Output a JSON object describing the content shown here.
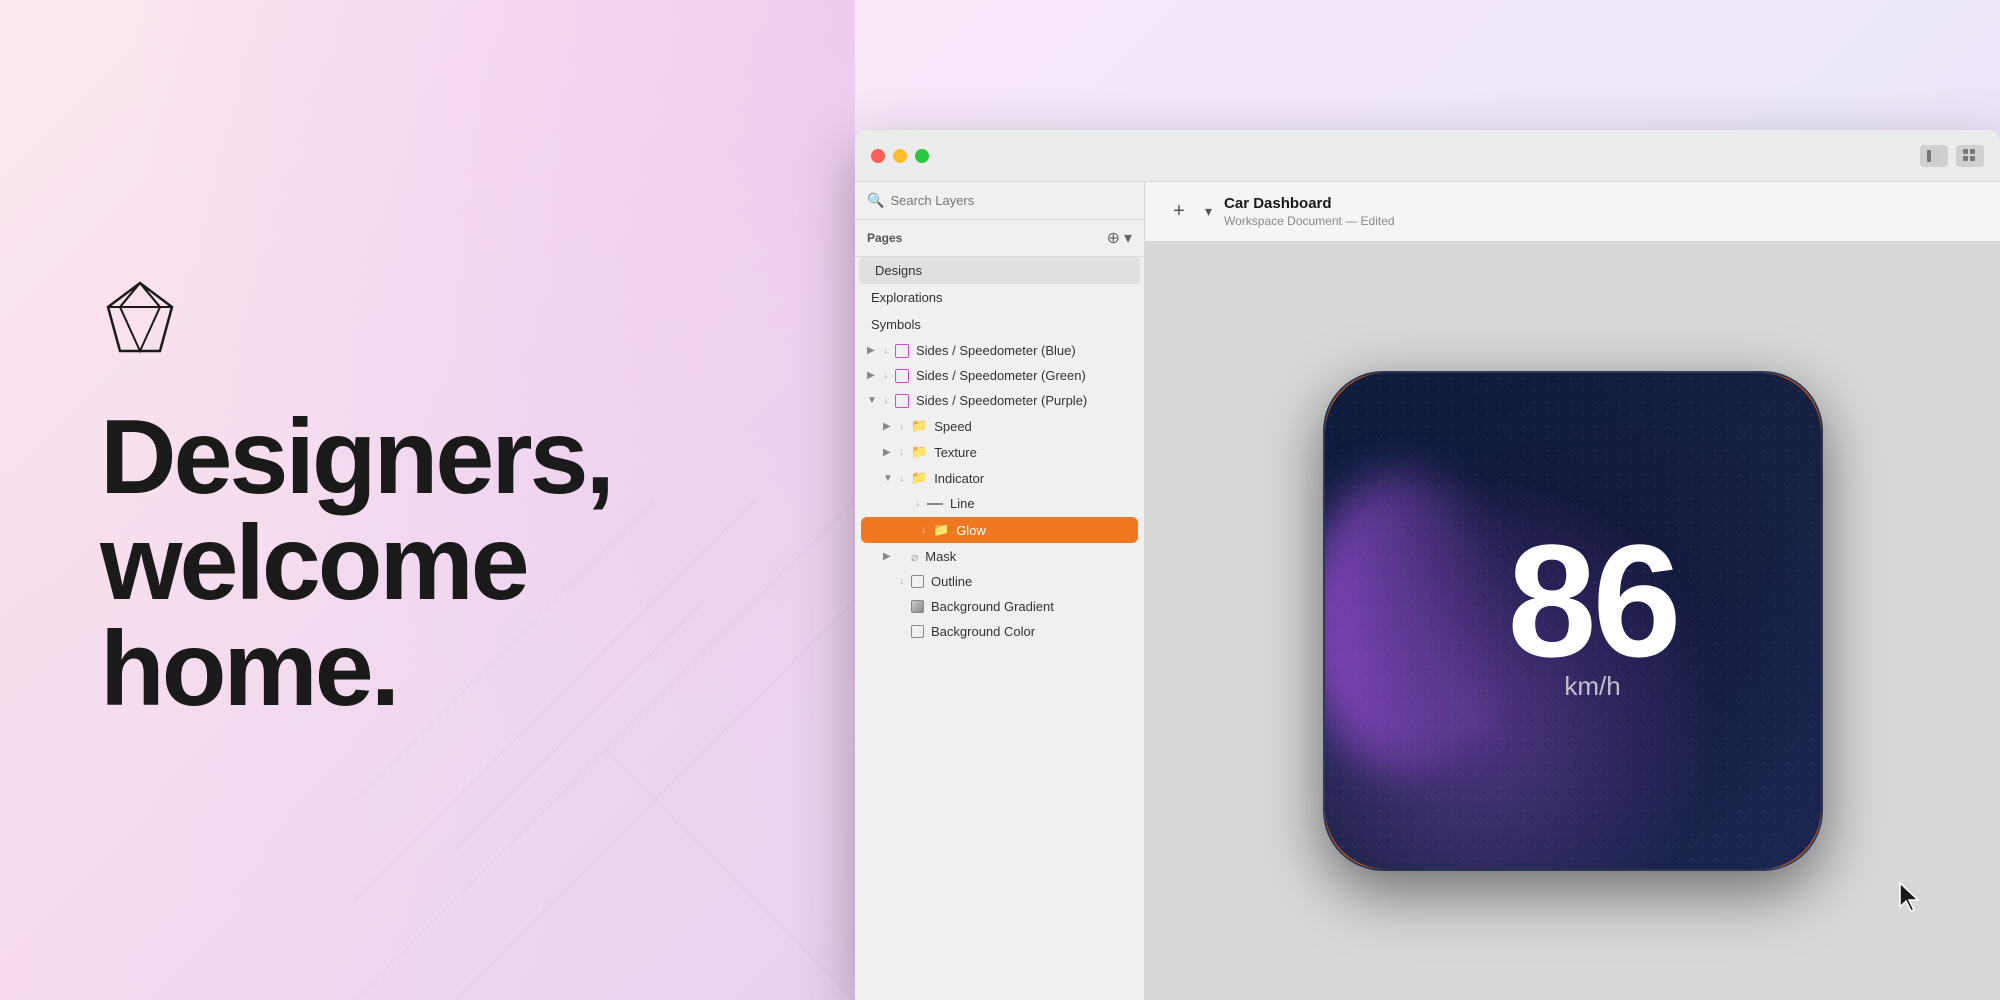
{
  "leftPanel": {
    "headline_line1": "Designers,",
    "headline_line2": "welcome",
    "headline_line3": "home."
  },
  "window": {
    "titlebar": {
      "traffic": [
        "red",
        "yellow",
        "green"
      ]
    },
    "header": {
      "title": "Car Dashboard",
      "subtitle": "Workspace Document — Edited",
      "add_label": "+",
      "chevron_label": "▾"
    },
    "search": {
      "placeholder": "Search Layers"
    },
    "pages": {
      "label": "Pages",
      "items": [
        "Designs",
        "Explorations",
        "Symbols"
      ]
    },
    "layers": [
      {
        "id": "speedometer-blue",
        "indent": 0,
        "label": "Sides / Speedometer (Blue)",
        "icon": "artboard",
        "chevron": "▶"
      },
      {
        "id": "speedometer-green",
        "indent": 0,
        "label": "Sides / Speedometer (Green)",
        "icon": "artboard",
        "chevron": "▶"
      },
      {
        "id": "speedometer-purple",
        "indent": 0,
        "label": "Sides / Speedometer (Purple)",
        "icon": "artboard",
        "chevron": "▼"
      },
      {
        "id": "speed",
        "indent": 1,
        "label": "Speed",
        "icon": "folder",
        "chevron": "▶"
      },
      {
        "id": "texture",
        "indent": 1,
        "label": "Texture",
        "icon": "folder",
        "chevron": "▶"
      },
      {
        "id": "indicator",
        "indent": 1,
        "label": "Indicator",
        "icon": "folder",
        "chevron": "▼"
      },
      {
        "id": "line",
        "indent": 2,
        "label": "Line",
        "icon": "line"
      },
      {
        "id": "glow",
        "indent": 2,
        "label": "Glow",
        "icon": "folder-orange",
        "selected": true
      },
      {
        "id": "mask",
        "indent": 1,
        "label": "Mask",
        "icon": "cloud",
        "chevron": "▶"
      },
      {
        "id": "outline",
        "indent": 1,
        "label": "Outline",
        "icon": "shape"
      },
      {
        "id": "background-gradient",
        "indent": 1,
        "label": "Background Gradient",
        "icon": "rect"
      },
      {
        "id": "background-color",
        "indent": 1,
        "label": "Background Color",
        "icon": "rect"
      }
    ],
    "speedometer": {
      "speed": "86",
      "unit": "km/h"
    }
  }
}
